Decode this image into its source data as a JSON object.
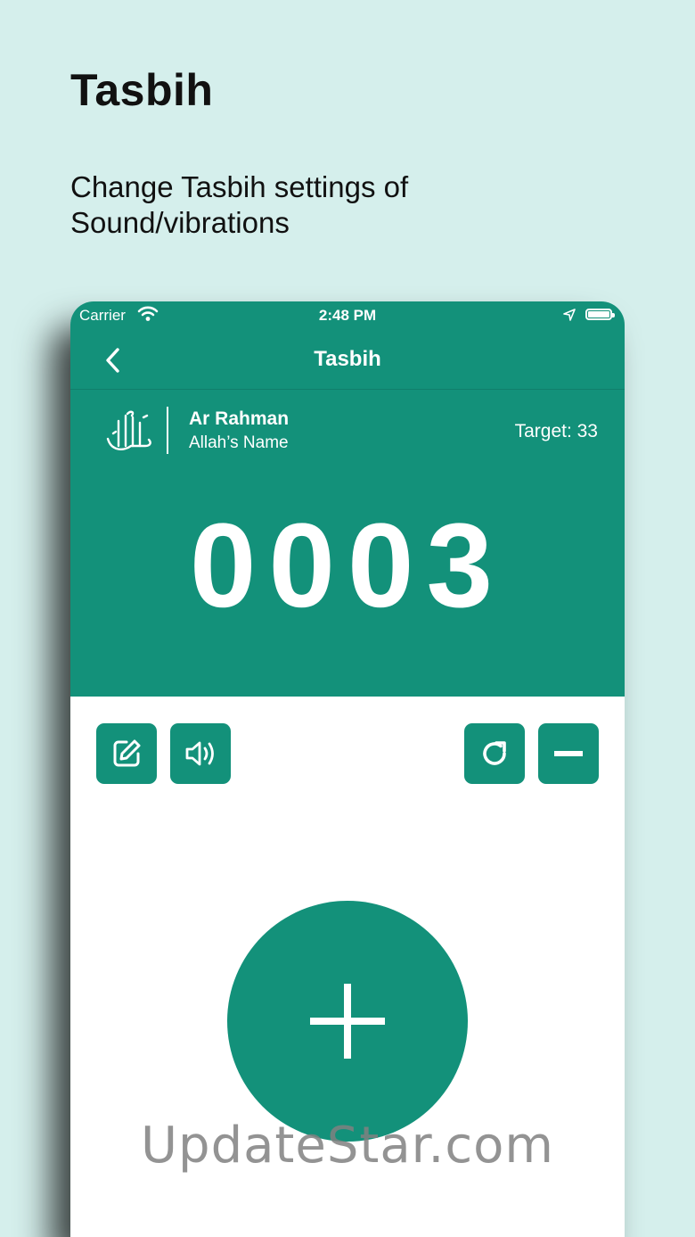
{
  "promo": {
    "title": "Tasbih",
    "subtitle": "Change Tasbih settings of Sound/vibrations"
  },
  "status_bar": {
    "carrier": "Carrier",
    "time": "2:48 PM"
  },
  "nav": {
    "title": "Tasbih",
    "back_icon": "chevron-left-icon"
  },
  "header": {
    "logo_icon": "allah-calligraphy-icon",
    "name": "Ar Rahman",
    "subtitle": "Allah’s Name",
    "target": "Target: 33"
  },
  "counter": {
    "value": "0003"
  },
  "toolbar": {
    "buttons": [
      {
        "name": "edit-button",
        "icon": "edit-icon"
      },
      {
        "name": "sound-button",
        "icon": "speaker-icon"
      },
      {
        "name": "reset-button",
        "icon": "refresh-icon"
      },
      {
        "name": "decrement-button",
        "icon": "minus-icon"
      }
    ]
  },
  "increment": {
    "icon": "plus-icon"
  },
  "watermark": "UpdateStar.com",
  "colors": {
    "background": "#d5efec",
    "accent": "#13917a",
    "surface": "#ffffff"
  }
}
